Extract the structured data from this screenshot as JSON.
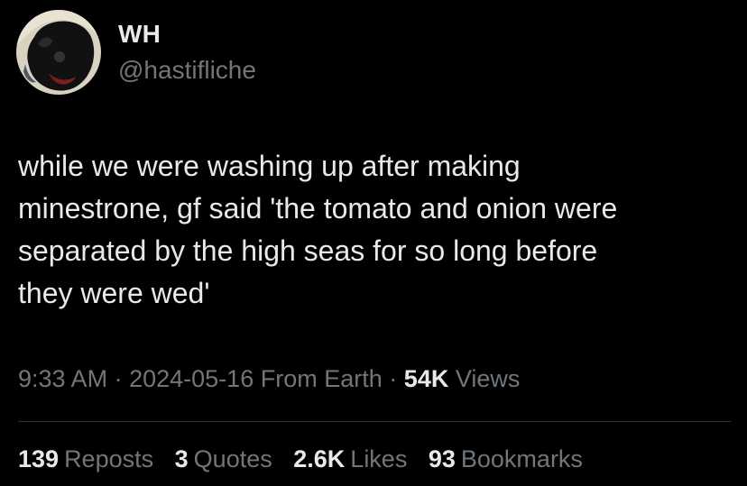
{
  "user": {
    "display_name": "WH",
    "handle": "@hastifliche",
    "avatar_icon": "profile-avatar-icon"
  },
  "tweet": {
    "lines": [
      "while we were washing up after making",
      "minestrone, gf said 'the tomato and onion were",
      "separated by the high seas for so long before",
      "they were wed'"
    ]
  },
  "meta": {
    "time": "9:33 AM",
    "sep1": "·",
    "date": "2024-05-16",
    "source": "From Earth",
    "sep2": "·",
    "views_count": "54K",
    "views_label": "Views"
  },
  "stats": {
    "reposts_count": "139",
    "reposts_label": "Reposts",
    "quotes_count": "3",
    "quotes_label": "Quotes",
    "likes_count": "2.6K",
    "likes_label": "Likes",
    "bookmarks_count": "93",
    "bookmarks_label": "Bookmarks"
  },
  "colors": {
    "background": "#000000",
    "primary_text": "#e7e9ea",
    "secondary_text": "#71767b",
    "divider": "#2f3336"
  }
}
